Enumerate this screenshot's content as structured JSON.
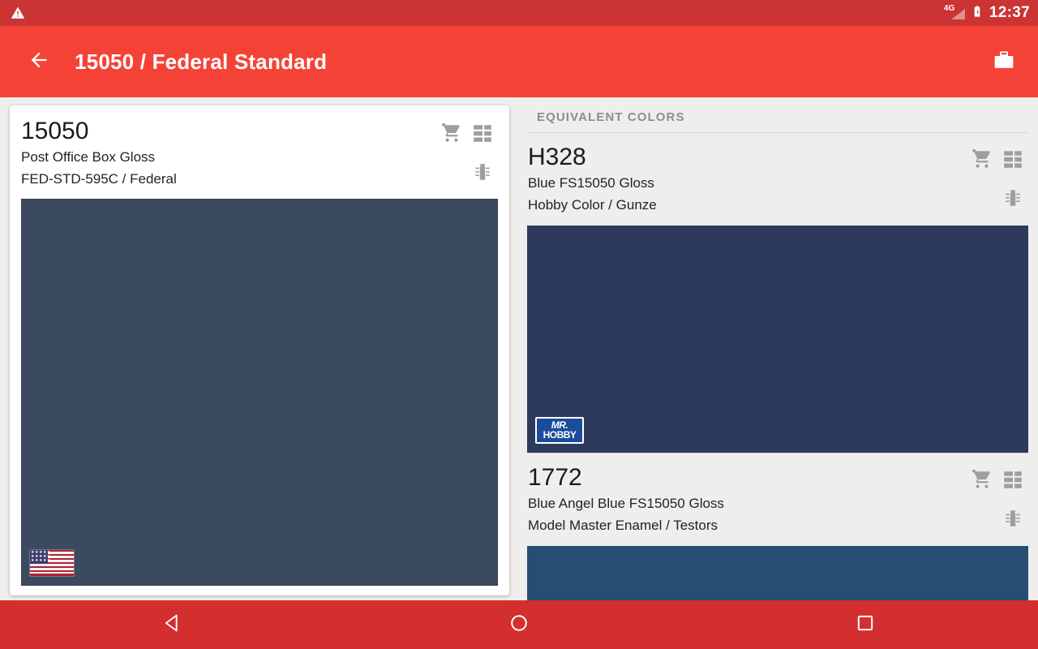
{
  "status_bar": {
    "warning_icon": "warning-triangle-icon",
    "network": "4G",
    "battery_icon": "battery-charging-icon",
    "time": "12:37"
  },
  "app_bar": {
    "back_icon": "arrow-back-icon",
    "title": "15050 / Federal Standard",
    "action_icon": "paint-bucket-icon"
  },
  "detail_card": {
    "code": "15050",
    "name": "Post Office Box Gloss",
    "brand": "FED-STD-595C / Federal",
    "swatch_color": "#3C4A5F",
    "badge": "us-flag",
    "icons": [
      "cart-icon",
      "grid-icon",
      "paint-tube-icon"
    ]
  },
  "equivalents": {
    "section_title": "EQUIVALENT COLORS",
    "items": [
      {
        "code": "H328",
        "name": "Blue FS15050 Gloss",
        "brand": "Hobby Color / Gunze",
        "swatch_color": "#2E3A5C",
        "badge": "mr-hobby",
        "badge_line1": "MR.",
        "badge_line2": "HOBBY"
      },
      {
        "code": "1772",
        "name": "Blue Angel Blue FS15050 Gloss",
        "brand": "Model Master Enamel / Testors",
        "swatch_color": "#274D74",
        "badge": ""
      }
    ]
  },
  "nav_bar": {
    "back": "nav-back-icon",
    "home": "nav-home-icon",
    "recents": "nav-recents-icon"
  },
  "colors": {
    "status_bar": "#CC3333",
    "app_bar": "#F44336",
    "nav_bar": "#D32F2F",
    "page_background": "#EFEEEC"
  }
}
